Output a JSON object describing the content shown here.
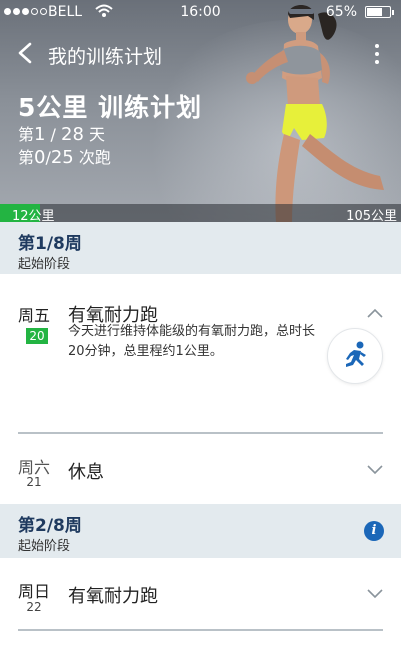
{
  "status_bar": {
    "carrier": "BELL",
    "time": "16:00",
    "battery": "65%"
  },
  "nav": {
    "title": "我的训练计划"
  },
  "plan": {
    "title": "5公里 训练计划",
    "day_prefix": "第",
    "day_current": "1",
    "day_sep": " / ",
    "day_total": "28",
    "day_suffix": " 天",
    "run_prefix": "第",
    "run_current": "0",
    "run_sep": "/",
    "run_total": "25",
    "run_suffix": " 次跑"
  },
  "progress": {
    "start_label": "12公里",
    "end_label": "105公里",
    "fraction": 0.1
  },
  "weeks": [
    {
      "title": "第1/8周",
      "subtitle": "起始阶段",
      "days": [
        {
          "weekday": "周五",
          "date": "20",
          "is_today": true,
          "name": "有氧耐力跑",
          "expanded": true,
          "description": "今天进行维持体能级的有氧耐力跑，总时长20分钟，总里程约1公里。"
        },
        {
          "weekday": "周六",
          "date": "21",
          "is_today": false,
          "name": "休息",
          "expanded": false
        }
      ]
    },
    {
      "title": "第2/8周",
      "subtitle": "起始阶段",
      "has_info": true,
      "days": [
        {
          "weekday": "周日",
          "date": "22",
          "is_today": false,
          "name": "有氧耐力跑",
          "expanded": false
        }
      ]
    }
  ],
  "icons": {
    "back": "chevron-left-icon",
    "more": "more-vertical-icon",
    "run": "runner-icon",
    "info": "info-icon",
    "expand": "chevron-down-icon",
    "collapse": "chevron-up-icon"
  },
  "colors": {
    "accent_green": "#23b442",
    "accent_blue": "#1b67b8",
    "week_header_bg": "#e3eaee"
  }
}
